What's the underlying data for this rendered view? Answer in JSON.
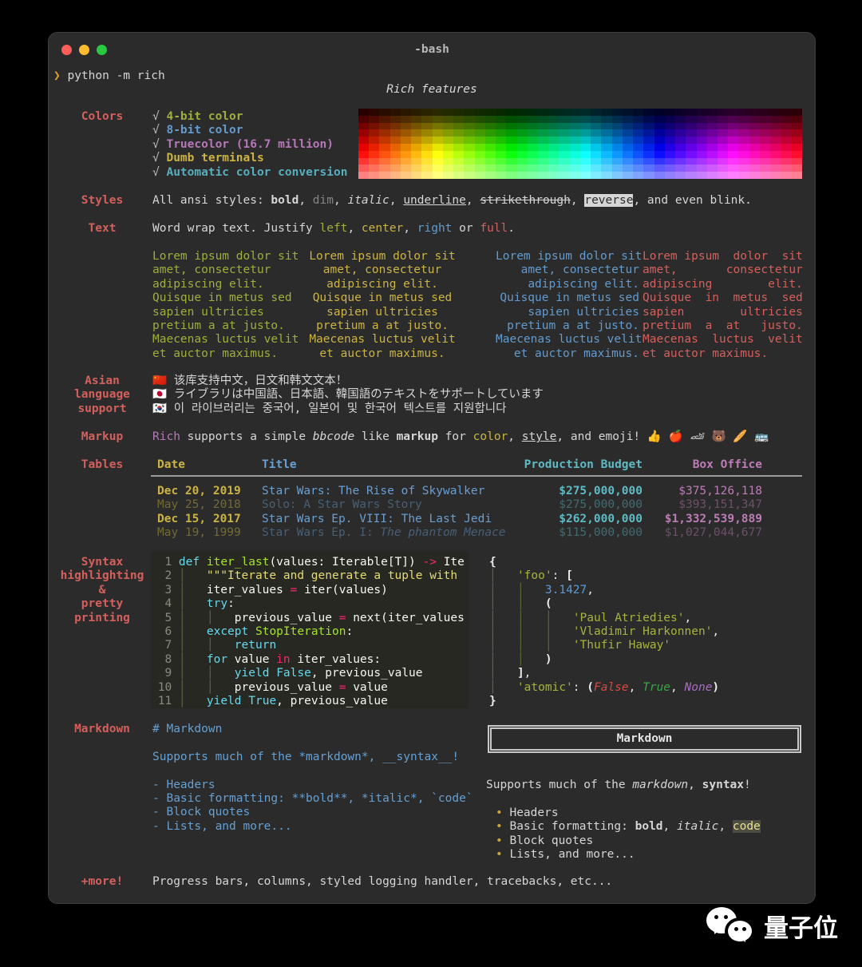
{
  "window": {
    "title": "-bash",
    "traffic_lights": [
      "#ff5f57",
      "#febc2e",
      "#28c840"
    ]
  },
  "prompt": {
    "symbol": "❯",
    "command": "python -m rich"
  },
  "heading": "Rich features",
  "palette": {
    "background": "#2b2b2b",
    "label_red": "#d4605d",
    "green": "#a0ae3c",
    "yellow": "#ccb444",
    "blue": "#639bce",
    "cyan": "#58aebd",
    "magenta": "#b678b8",
    "code_bg": "#272822"
  },
  "colors": {
    "label": "Colors",
    "check_char": "√",
    "items": [
      {
        "text": "4-bit color",
        "color": "grn"
      },
      {
        "text": "8-bit color",
        "color": "blu"
      },
      {
        "text": "Truecolor (16.7 million)",
        "color": "mag"
      },
      {
        "text": "Dumb terminals",
        "color": "yel"
      },
      {
        "text": "Automatic color conversion",
        "color": "cyn"
      }
    ],
    "spectrum": {
      "columns": 42,
      "rows": 10,
      "hue_start": 0,
      "hue_end": 360,
      "saturation": 100,
      "lightness_start": 8,
      "lightness_end": 75
    }
  },
  "styles": {
    "label": "Styles",
    "segments": [
      {
        "t": "All ansi styles: ",
        "s": "w"
      },
      {
        "t": "bold",
        "s": "b"
      },
      {
        "t": ", ",
        "s": "w"
      },
      {
        "t": "dim",
        "s": "d"
      },
      {
        "t": ", ",
        "s": "w"
      },
      {
        "t": "italic",
        "s": "i"
      },
      {
        "t": ", ",
        "s": "w"
      },
      {
        "t": "underline",
        "s": "u"
      },
      {
        "t": ", ",
        "s": "w"
      },
      {
        "t": "strikethrough",
        "s": "st"
      },
      {
        "t": ", ",
        "s": "w"
      },
      {
        "t": "reverse",
        "s": "rv"
      },
      {
        "t": ", and even blink.",
        "s": "w"
      }
    ]
  },
  "text_section": {
    "label": "Text",
    "intro": [
      {
        "t": "Word wrap text. Justify ",
        "s": "w"
      },
      {
        "t": "left",
        "s": "grn"
      },
      {
        "t": ", ",
        "s": "w"
      },
      {
        "t": "center",
        "s": "yel"
      },
      {
        "t": ", ",
        "s": "w"
      },
      {
        "t": "right",
        "s": "blu"
      },
      {
        "t": " or ",
        "s": "w"
      },
      {
        "t": "full",
        "s": "red"
      },
      {
        "t": ".",
        "s": "w"
      }
    ],
    "columns": [
      {
        "justify": "left",
        "color": "green",
        "text": "Lorem ipsum dolor sit\namet, consectetur\nadipiscing elit.\nQuisque in metus sed\nsapien ultricies\npretium a at justo.\nMaecenas luctus velit\net auctor maximus."
      },
      {
        "justify": "center",
        "color": "yellow",
        "text": "Lorem ipsum dolor sit\namet, consectetur\nadipiscing elit.\nQuisque in metus sed\nsapien ultricies\npretium a at justo.\nMaecenas luctus velit\net auctor maximus."
      },
      {
        "justify": "right",
        "color": "blue",
        "text": "Lorem ipsum dolor sit\namet, consectetur\nadipiscing elit.\nQuisque in metus sed\nsapien ultricies\npretium a at justo.\nMaecenas luctus velit\net auctor maximus."
      },
      {
        "justify": "full",
        "color": "red",
        "text": "Lorem ipsum  dolor  sit\namet,       consectetur\nadipiscing        elit.\nQuisque  in  metus  sed\nsapien        ultricies\npretium  a  at   justo.\nMaecenas  luctus  velit\net auctor maximus."
      }
    ]
  },
  "asian": {
    "label": "Asian\nlanguage\nsupport",
    "text": "🇨🇳 该库支持中文，日文和韩文文本！\n🇯🇵 ライブラリは中国語、日本語、韓国語のテキストをサポートしています\n🇰🇷 이 라이브러리는 중국어, 일본어 및 한국어 텍스트를 지원합니다"
  },
  "markup": {
    "label": "Markup",
    "segments": [
      {
        "t": "Rich",
        "s": "mag"
      },
      {
        "t": " supports a simple ",
        "s": "w"
      },
      {
        "t": "bbcode",
        "s": "i"
      },
      {
        "t": " like ",
        "s": "w"
      },
      {
        "t": "markup",
        "s": "b"
      },
      {
        "t": " for ",
        "s": "w"
      },
      {
        "t": "color",
        "s": "yel"
      },
      {
        "t": ", ",
        "s": "w"
      },
      {
        "t": "style",
        "s": "u"
      },
      {
        "t": ", and emoji! ",
        "s": "w"
      },
      {
        "t": "👍 🍎 🏎 🐻 🥖 🚌",
        "s": "w"
      }
    ]
  },
  "tables": {
    "label": "Tables",
    "headers": {
      "date": "Date",
      "title": "Title",
      "budget": "Production Budget",
      "box_office": "Box Office"
    },
    "rows": [
      {
        "date": "Dec 20, 2019",
        "title": [
          {
            "t": "Star Wars: The Rise of Skywalker",
            "s": "w"
          }
        ],
        "budget": "$275,000,000",
        "box_office": "$375,126,118",
        "dim": false,
        "box_office_bold": false
      },
      {
        "date": "May 25, 2018",
        "title": [
          {
            "t": "Solo: A Star Wars Story",
            "s": "w"
          }
        ],
        "budget": "$275,000,000",
        "box_office": "$393,151,347",
        "dim": true,
        "box_office_bold": false
      },
      {
        "date": "Dec 15, 2017",
        "title": [
          {
            "t": "Star Wars Ep. VIII: The Last Jedi",
            "s": "w"
          }
        ],
        "budget": "$262,000,000",
        "box_office": "$1,332,539,889",
        "dim": false,
        "box_office_bold": true
      },
      {
        "date": "May 19, 1999",
        "title": [
          {
            "t": "Star Wars Ep. I: ",
            "s": "w"
          },
          {
            "t": "The phantom Menace",
            "s": "i"
          }
        ],
        "budget": "$115,000,000",
        "box_office": "$1,027,044,677",
        "dim": true,
        "box_office_bold": false
      }
    ]
  },
  "syntax": {
    "label": "Syntax\nhighlighting\n&\npretty\nprinting",
    "code_lines": [
      [
        {
          "t": "  1 ",
          "s": "mn"
        },
        {
          "t": "def",
          "s": "mc"
        },
        {
          "t": " ",
          "s": "mw"
        },
        {
          "t": "iter_last",
          "s": "mg"
        },
        {
          "t": "(values: Iterable[T]) ",
          "s": "mw"
        },
        {
          "t": "->",
          "s": "mp"
        },
        {
          "t": " Ite",
          "s": "mw"
        }
      ],
      [
        {
          "t": "  2 ",
          "s": "mn"
        },
        {
          "t": "│",
          "s": "gd"
        },
        {
          "t": "   \"\"\"Iterate and generate a tuple with ",
          "s": "my"
        }
      ],
      [
        {
          "t": "  3 ",
          "s": "mn"
        },
        {
          "t": "│",
          "s": "gd"
        },
        {
          "t": "   iter_values ",
          "s": "mw"
        },
        {
          "t": "=",
          "s": "mp"
        },
        {
          "t": " iter(values)",
          "s": "mw"
        }
      ],
      [
        {
          "t": "  4 ",
          "s": "mn"
        },
        {
          "t": "│",
          "s": "gd"
        },
        {
          "t": "   ",
          "s": "mw"
        },
        {
          "t": "try",
          "s": "mc"
        },
        {
          "t": ":",
          "s": "mw"
        }
      ],
      [
        {
          "t": "  5 ",
          "s": "mn"
        },
        {
          "t": "│",
          "s": "gd"
        },
        {
          "t": "   ",
          "s": "mw"
        },
        {
          "t": "│",
          "s": "gd"
        },
        {
          "t": "   previous_value ",
          "s": "mw"
        },
        {
          "t": "=",
          "s": "mp"
        },
        {
          "t": " next(iter_values",
          "s": "mw"
        }
      ],
      [
        {
          "t": "  6 ",
          "s": "mn"
        },
        {
          "t": "│",
          "s": "gd"
        },
        {
          "t": "   ",
          "s": "mw"
        },
        {
          "t": "except",
          "s": "mc"
        },
        {
          "t": " ",
          "s": "mw"
        },
        {
          "t": "StopIteration",
          "s": "mg"
        },
        {
          "t": ":",
          "s": "mw"
        }
      ],
      [
        {
          "t": "  7 ",
          "s": "mn"
        },
        {
          "t": "│",
          "s": "gd"
        },
        {
          "t": "   ",
          "s": "mw"
        },
        {
          "t": "│",
          "s": "gd"
        },
        {
          "t": "   ",
          "s": "mw"
        },
        {
          "t": "return",
          "s": "mc"
        }
      ],
      [
        {
          "t": "  8 ",
          "s": "mn"
        },
        {
          "t": "│",
          "s": "gd"
        },
        {
          "t": "   ",
          "s": "mw"
        },
        {
          "t": "for",
          "s": "mc"
        },
        {
          "t": " value ",
          "s": "mw"
        },
        {
          "t": "in",
          "s": "mp"
        },
        {
          "t": " iter_values:",
          "s": "mw"
        }
      ],
      [
        {
          "t": "  9 ",
          "s": "mn"
        },
        {
          "t": "│",
          "s": "gd"
        },
        {
          "t": "   ",
          "s": "mw"
        },
        {
          "t": "│",
          "s": "gd"
        },
        {
          "t": "   ",
          "s": "mw"
        },
        {
          "t": "yield",
          "s": "mc"
        },
        {
          "t": " ",
          "s": "mw"
        },
        {
          "t": "False",
          "s": "mc"
        },
        {
          "t": ", previous_value",
          "s": "mw"
        }
      ],
      [
        {
          "t": " 10 ",
          "s": "mn"
        },
        {
          "t": "│",
          "s": "gd"
        },
        {
          "t": "   ",
          "s": "mw"
        },
        {
          "t": "│",
          "s": "gd"
        },
        {
          "t": "   previous_value ",
          "s": "mw"
        },
        {
          "t": "=",
          "s": "mp"
        },
        {
          "t": " value",
          "s": "mw"
        }
      ],
      [
        {
          "t": " 11 ",
          "s": "mn"
        },
        {
          "t": "│",
          "s": "gd"
        },
        {
          "t": "   ",
          "s": "mw"
        },
        {
          "t": "yield",
          "s": "mc"
        },
        {
          "t": " ",
          "s": "mw"
        },
        {
          "t": "True",
          "s": "mc"
        },
        {
          "t": ", previous_value",
          "s": "mw"
        }
      ]
    ],
    "pretty_lines": [
      [
        {
          "t": "{",
          "s": "pb"
        }
      ],
      [
        {
          "t": "│",
          "s": "pg"
        },
        {
          "t": "   ",
          "s": "pw"
        },
        {
          "t": "'foo'",
          "s": "ps"
        },
        {
          "t": ": ",
          "s": "pw"
        },
        {
          "t": "[",
          "s": "pb"
        }
      ],
      [
        {
          "t": "│",
          "s": "pg"
        },
        {
          "t": "   ",
          "s": "pw"
        },
        {
          "t": "│",
          "s": "pg"
        },
        {
          "t": "   ",
          "s": "pw"
        },
        {
          "t": "3.1427",
          "s": "pnum"
        },
        {
          "t": ",",
          "s": "pw"
        }
      ],
      [
        {
          "t": "│",
          "s": "pg"
        },
        {
          "t": "   ",
          "s": "pw"
        },
        {
          "t": "│",
          "s": "pg"
        },
        {
          "t": "   ",
          "s": "pw"
        },
        {
          "t": "(",
          "s": "pb"
        }
      ],
      [
        {
          "t": "│",
          "s": "pg"
        },
        {
          "t": "   ",
          "s": "pw"
        },
        {
          "t": "│",
          "s": "pg"
        },
        {
          "t": "   ",
          "s": "pw"
        },
        {
          "t": "│",
          "s": "pg"
        },
        {
          "t": "   ",
          "s": "pw"
        },
        {
          "t": "'Paul Atriedies'",
          "s": "ps"
        },
        {
          "t": ",",
          "s": "pw"
        }
      ],
      [
        {
          "t": "│",
          "s": "pg"
        },
        {
          "t": "   ",
          "s": "pw"
        },
        {
          "t": "│",
          "s": "pg"
        },
        {
          "t": "   ",
          "s": "pw"
        },
        {
          "t": "│",
          "s": "pg"
        },
        {
          "t": "   ",
          "s": "pw"
        },
        {
          "t": "'Vladimir Harkonnen'",
          "s": "ps"
        },
        {
          "t": ",",
          "s": "pw"
        }
      ],
      [
        {
          "t": "│",
          "s": "pg"
        },
        {
          "t": "   ",
          "s": "pw"
        },
        {
          "t": "│",
          "s": "pg"
        },
        {
          "t": "   ",
          "s": "pw"
        },
        {
          "t": "│",
          "s": "pg"
        },
        {
          "t": "   ",
          "s": "pw"
        },
        {
          "t": "'Thufir Haway'",
          "s": "ps"
        }
      ],
      [
        {
          "t": "│",
          "s": "pg"
        },
        {
          "t": "   ",
          "s": "pw"
        },
        {
          "t": "│",
          "s": "pg"
        },
        {
          "t": "   ",
          "s": "pw"
        },
        {
          "t": ")",
          "s": "pb"
        }
      ],
      [
        {
          "t": "│",
          "s": "pg"
        },
        {
          "t": "   ",
          "s": "pw"
        },
        {
          "t": "]",
          "s": "pb"
        },
        {
          "t": ",",
          "s": "pw"
        }
      ],
      [
        {
          "t": "│",
          "s": "pg"
        },
        {
          "t": "   ",
          "s": "pw"
        },
        {
          "t": "'atomic'",
          "s": "ps"
        },
        {
          "t": ": ",
          "s": "pw"
        },
        {
          "t": "(",
          "s": "pb"
        },
        {
          "t": "False",
          "s": "pf"
        },
        {
          "t": ", ",
          "s": "pw"
        },
        {
          "t": "True",
          "s": "pt"
        },
        {
          "t": ", ",
          "s": "pw"
        },
        {
          "t": "None",
          "s": "po"
        },
        {
          "t": ")",
          "s": "pb"
        }
      ],
      [
        {
          "t": "}",
          "s": "pb"
        }
      ]
    ]
  },
  "markdown": {
    "label": "Markdown",
    "raw": "# Markdown\n\nSupports much of the *markdown*, __syntax__!\n\n- Headers\n- Basic formatting: **bold**, *italic*, `code`\n- Block quotes\n- Lists, and more...",
    "rendered": {
      "box_title": "Markdown",
      "para": [
        {
          "t": "Supports much of the ",
          "s": "w"
        },
        {
          "t": "markdown",
          "s": "i"
        },
        {
          "t": ", ",
          "s": "w"
        },
        {
          "t": "syntax",
          "s": "b"
        },
        {
          "t": "!",
          "s": "w"
        }
      ],
      "bullet_char": "•",
      "bullets": [
        [
          {
            "t": "Headers",
            "s": "w"
          }
        ],
        [
          {
            "t": "Basic formatting: ",
            "s": "w"
          },
          {
            "t": "bold",
            "s": "b"
          },
          {
            "t": ", ",
            "s": "w"
          },
          {
            "t": "italic",
            "s": "i"
          },
          {
            "t": ", ",
            "s": "w"
          },
          {
            "t": "code",
            "s": "cd"
          }
        ],
        [
          {
            "t": "Block quotes",
            "s": "w"
          }
        ],
        [
          {
            "t": "Lists, and more...",
            "s": "w"
          }
        ]
      ]
    }
  },
  "more": {
    "label": "+more!",
    "text": "Progress bars, columns, styled logging handler, tracebacks, etc..."
  },
  "watermark": {
    "text": "量子位"
  }
}
